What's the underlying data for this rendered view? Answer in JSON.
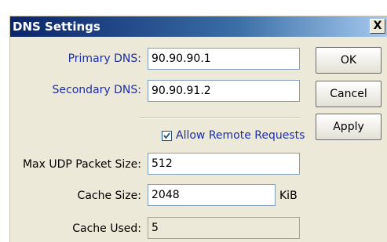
{
  "window": {
    "title": "DNS Settings",
    "close_label": "X"
  },
  "fields": {
    "primary_dns": {
      "label": "Primary DNS:",
      "value": "90.90.90.1"
    },
    "secondary_dns": {
      "label": "Secondary DNS:",
      "value": "90.90.91.2"
    },
    "allow_remote": {
      "label": "Allow Remote Requests",
      "checked": true
    },
    "max_udp": {
      "label": "Max UDP Packet Size:",
      "value": "512"
    },
    "cache_size": {
      "label": "Cache Size:",
      "value": "2048",
      "unit": "KiB"
    },
    "cache_used": {
      "label": "Cache Used:",
      "value": "5"
    }
  },
  "buttons": {
    "ok": "OK",
    "cancel": "Cancel",
    "apply": "Apply"
  },
  "colors": {
    "titlebar_start": "#0a246a",
    "titlebar_end": "#a6caf0",
    "label_blue": "#1d2fa8",
    "dialog_bg": "#ece9d8"
  }
}
